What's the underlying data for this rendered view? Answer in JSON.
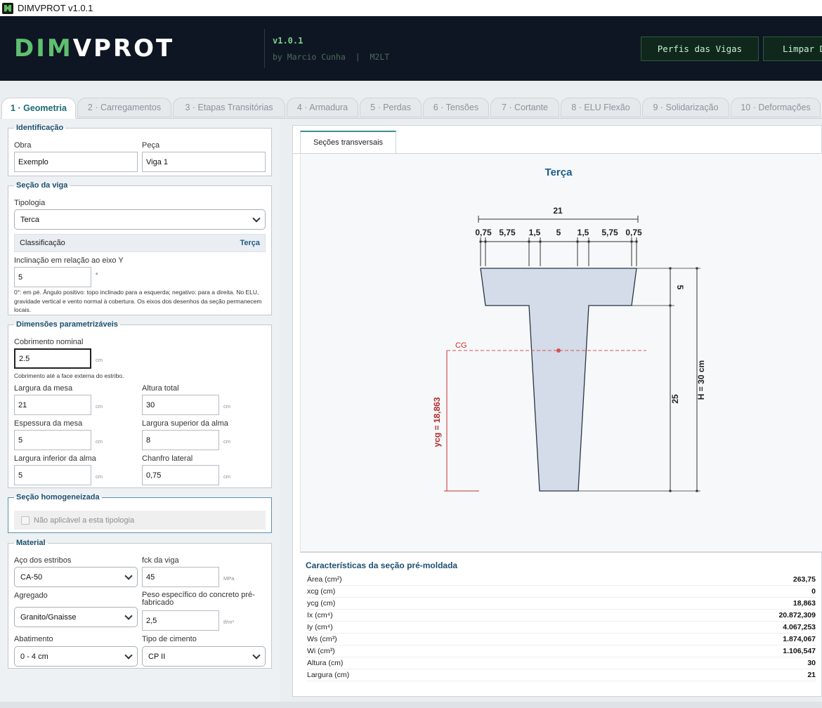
{
  "window": {
    "title": "DIMVPROT v1.0.1",
    "icon": "app-icon"
  },
  "header": {
    "logo_left": "DIM",
    "logo_right": "VPROT",
    "version": "v1.0.1",
    "byline": "by Marcio Cunha  |  M2LT",
    "buttons": [
      "Perfis das Vigas",
      "Limpar D"
    ]
  },
  "tabs": [
    {
      "label": "1 · Geometria",
      "active": true
    },
    {
      "label": "2 · Carregamentos"
    },
    {
      "label": "3 · Etapas Transitórias"
    },
    {
      "label": "4 · Armadura"
    },
    {
      "label": "5 · Perdas"
    },
    {
      "label": "6 · Tensões"
    },
    {
      "label": "7 · Cortante"
    },
    {
      "label": "8 · ELU Flexão"
    },
    {
      "label": "9 · Solidarização"
    },
    {
      "label": "10 · Deformações"
    }
  ],
  "identificacao": {
    "legend": "Identificação",
    "obra_label": "Obra",
    "obra_value": "Exemplo",
    "peca_label": "Peça",
    "peca_value": "Viga 1"
  },
  "secao": {
    "legend": "Seção da viga",
    "tipologia_label": "Tipologia",
    "tipologia_value": "Terca",
    "classificacao_label": "Classificação",
    "classificacao_value": "Terça",
    "inclinacao_label": "Inclinação em relação ao eixo Y",
    "inclinacao_value": "5",
    "inclinacao_unit": "°",
    "note": "0°: em pé. Ângulo positivo: topo inclinado para a esquerda; negativo: para a direita. No ELU, gravidade vertical e vento normal à cobertura. Os eixos dos desenhos da seção permanecem locais."
  },
  "dimensoes": {
    "legend": "Dimensões parametrizáveis",
    "cobrimento_label": "Cobrimento nominal",
    "cobrimento_value": "2.5",
    "cobrimento_unit": "cm",
    "cobrimento_note": "Cobrimento até a face externa do estribo.",
    "largura_mesa_label": "Largura da mesa",
    "largura_mesa_value": "21",
    "largura_mesa_unit": "cm",
    "altura_total_label": "Altura total",
    "altura_total_value": "30",
    "altura_total_unit": "cm",
    "espessura_mesa_label": "Espessura da mesa",
    "espessura_mesa_value": "5",
    "espessura_mesa_unit": "cm",
    "larg_sup_alma_label": "Largura superior da alma",
    "larg_sup_alma_value": "8",
    "larg_sup_alma_unit": "cm",
    "larg_inf_alma_label": "Largura inferior da alma",
    "larg_inf_alma_value": "5",
    "larg_inf_alma_unit": "cm",
    "chanfro_label": "Chanfro lateral",
    "chanfro_value": "0,75",
    "chanfro_unit": "cm"
  },
  "homogeneizada": {
    "legend": "Seção homogeneizada",
    "checkbox_label": "Não aplicável a esta tipologia"
  },
  "material": {
    "legend": "Material",
    "aco_label": "Aço dos estribos",
    "aco_value": "CA-50",
    "fck_label": "fck da viga",
    "fck_value": "45",
    "fck_unit": "MPa",
    "agregado_label": "Agregado",
    "agregado_value": "Granito/Gnaisse",
    "peso_label": "Peso específico do concreto pré-fabricado",
    "peso_value": "2,5",
    "peso_unit": "tf/m³",
    "abatimento_label": "Abatimento",
    "abatimento_value": "0 - 4 cm",
    "cimento_label": "Tipo de cimento",
    "cimento_value": "CP II"
  },
  "drawing": {
    "subtab": "Seções transversais",
    "title": "Terça",
    "dims_top_total": "21",
    "dims_top": [
      "0,75",
      "5,75",
      "1,5",
      "5",
      "1,5",
      "5,75",
      "0,75"
    ],
    "dim_mesa": "5",
    "dim_alma": "25",
    "dim_h": "H = 30 cm",
    "cg_label": "CG",
    "ycg_label": "ycg = 18,863"
  },
  "caracteristicas": {
    "title": "Características da seção pré-moldada",
    "rows": [
      {
        "k": "Área (cm²)",
        "v": "263,75"
      },
      {
        "k": "xcg (cm)",
        "v": "0"
      },
      {
        "k": "ycg (cm)",
        "v": "18,863"
      },
      {
        "k": "Ix (cm⁴)",
        "v": "20.872,309"
      },
      {
        "k": "Iy (cm⁴)",
        "v": "4.067,253"
      },
      {
        "k": "Ws (cm³)",
        "v": "1.874,067"
      },
      {
        "k": "Wi (cm³)",
        "v": "1.106,547"
      },
      {
        "k": "Altura (cm)",
        "v": "30"
      },
      {
        "k": "Largura (cm)",
        "v": "21"
      }
    ]
  },
  "colors": {
    "header_bg": "#0e1624",
    "accent_green": "#5fbf6f",
    "tab_active": "#1a6b73",
    "legend_blue": "#1d4f6f",
    "section_fill": "#d3dce8",
    "cg_red": "#d9534f"
  }
}
